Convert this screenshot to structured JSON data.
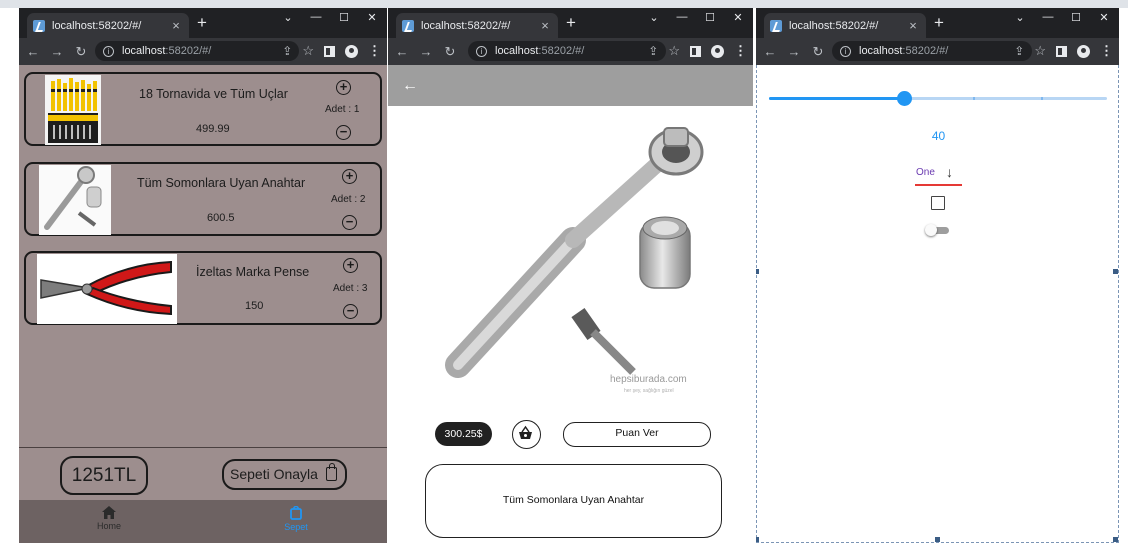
{
  "browser": {
    "tab_title": "localhost:58202/#/",
    "url_host": "localhost",
    "url_path": ":58202/#/",
    "new_tab": "+",
    "close_tab": "×",
    "minimize": "⌄",
    "min2": "—",
    "maximize": "☐",
    "close_window": "✕"
  },
  "cart": {
    "items": [
      {
        "name": "18 Tornavida ve Tüm Uçlar",
        "price": "499.99",
        "qty": "Adet : 1"
      },
      {
        "name": "Tüm Somonlara Uyan Anahtar",
        "price": "600.5",
        "qty": "Adet : 2"
      },
      {
        "name": "İzeltas Marka Pense",
        "price": "150",
        "qty": "Adet : 3"
      }
    ],
    "total": "1251TL",
    "confirm_label": "Sepeti Onayla",
    "nav": [
      {
        "label": "Home",
        "icon": "home-icon",
        "active": false
      },
      {
        "label": "Sepet",
        "icon": "cart-icon",
        "active": true
      }
    ],
    "colors": {
      "background": "#9d8e8e",
      "nav_background": "#6d6262",
      "active": "#2196f3"
    }
  },
  "detail": {
    "price": "300.25$",
    "rate_label": "Puan Ver",
    "description": "Tüm Somonlara Uyan Anahtar",
    "watermark": "hepsiburada.com",
    "watermark_sub": "her şey, sağlığın güzel"
  },
  "widgets": {
    "slider_value": "40",
    "slider_fraction": 0.4,
    "dropdown_value": "One",
    "checkbox_checked": false,
    "switch_on": false,
    "accent": "#2196f3"
  }
}
